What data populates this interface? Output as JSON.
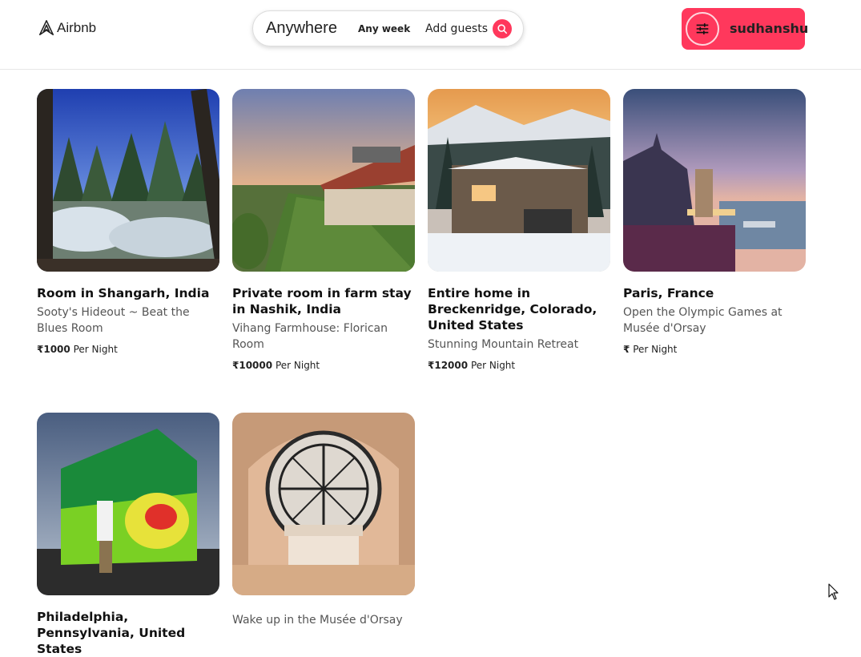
{
  "header": {
    "logo_text": "Airbnb",
    "search": {
      "anywhere": "Anywhere",
      "week": "Any week",
      "guests": "Add guests"
    },
    "user": {
      "name": "sudhanshu"
    }
  },
  "listings": [
    {
      "title": "Room in Shangarh, India",
      "subtitle": "Sooty's Hideout ~ Beat the Blues Room",
      "currency": "₹",
      "price": "1000",
      "per": "Per Night"
    },
    {
      "title": "Private room in farm stay in Nashik, India",
      "subtitle": "Vihang Farmhouse: Florican Room",
      "currency": "₹",
      "price": "10000",
      "per": "Per Night"
    },
    {
      "title": "Entire home in Breckenridge, Colorado, United States",
      "subtitle": "Stunning Mountain Retreat",
      "currency": "₹",
      "price": "12000",
      "per": "Per Night"
    },
    {
      "title": "Paris, France",
      "subtitle": "Open the Olympic Games at Musée d'Orsay",
      "currency": "₹",
      "price": "",
      "per": "Per Night"
    },
    {
      "title": "Philadelphia, Pennsylvania, United States",
      "subtitle": "",
      "currency": "",
      "price": "",
      "per": ""
    },
    {
      "title": "",
      "subtitle": "Wake up in the Musée d'Orsay",
      "currency": "",
      "price": "",
      "per": ""
    }
  ],
  "colors": {
    "brand": "#ff385c"
  }
}
